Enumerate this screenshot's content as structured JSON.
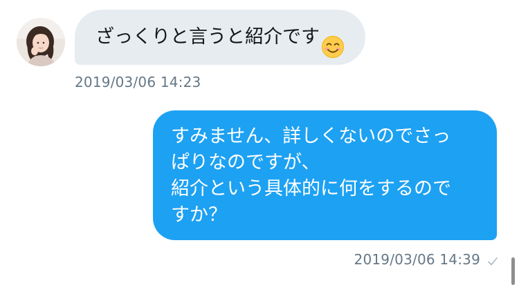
{
  "conversation": {
    "incoming": {
      "text": "ざっくりと言うと紹介です",
      "emoji": "smiling-face-emoji",
      "timestamp": "2019/03/06 14:23"
    },
    "outgoing": {
      "lines": [
        "すみません、詳しくないのでさっ",
        "ぱりなのですが、",
        "紹介という具体的に何をするので",
        "すか？"
      ],
      "timestamp": "2019/03/06 14:39",
      "status_icon": "checkmark-icon"
    }
  },
  "colors": {
    "incoming_bubble": "#e6ecf0",
    "outgoing_bubble": "#1da1f2",
    "timestamp_text": "#657786"
  }
}
